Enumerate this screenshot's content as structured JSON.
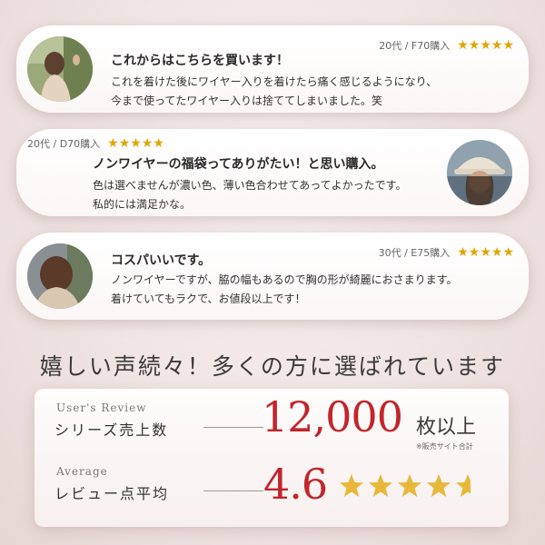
{
  "reviews": [
    {
      "meta": "20代 / F70購入",
      "stars": "★★★★★",
      "title": "これからはこちらを買います！",
      "lines": [
        "これを着けた後にワイヤー入りを着けたら痛く感じるようになり、",
        "今まで使ってたワイヤー入りは捨ててしまいました。笑"
      ]
    },
    {
      "meta": "20代 / D70購入",
      "stars": "★★★★★",
      "title": "ノンワイヤーの福袋ってありがたい！と思い購入。",
      "lines": [
        "色は選べませんが濃い色、薄い色合わせてあってよかったです。",
        "私的には満足かな。"
      ]
    },
    {
      "meta": "30代 / E75購入",
      "stars": "★★★★★",
      "title": "コスパいいです。",
      "lines": [
        "ノンワイヤーですが、脇の幅もあるので胸の形が綺麗におさまります。",
        "着けていてもラクで、お値段以上です！"
      ]
    }
  ],
  "headline": "嬉しい声続々！多くの方に選ばれています",
  "stats": {
    "sales": {
      "label_en": "User's Review",
      "label_jp": "シリーズ売上数",
      "value": "12,000",
      "unit": "枚以上",
      "note": "※販売サイト合計"
    },
    "rating": {
      "label_en": "Average",
      "label_jp": "レビュー点平均",
      "value": "4.6",
      "stars_filled": 4.6,
      "stars_max": 5
    }
  },
  "colors": {
    "accent_red": "#c2252b",
    "star_gold": "#e0a500",
    "rating_star": "#e8b83a"
  },
  "icons": [
    "star-icon"
  ]
}
